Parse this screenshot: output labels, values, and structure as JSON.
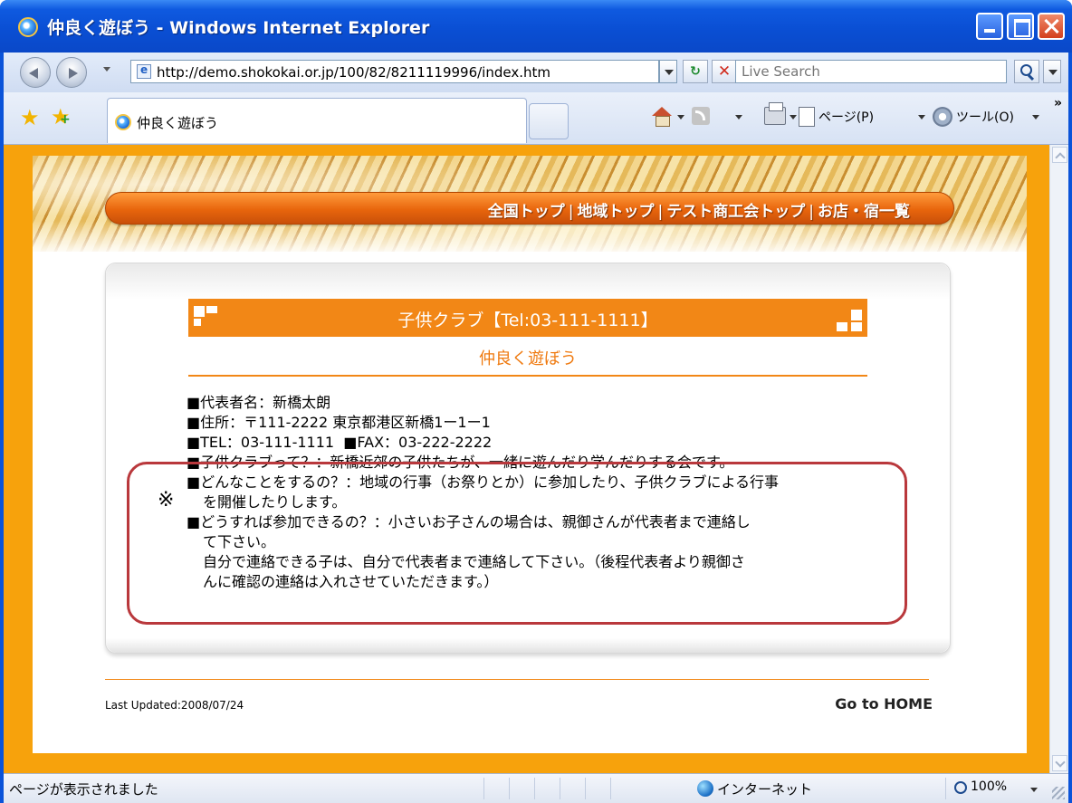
{
  "window": {
    "title": "仲良く遊ぼう - Windows Internet Explorer"
  },
  "toolbar": {
    "address": "http://demo.shokokai.or.jp/100/82/8211119996/index.htm",
    "search_placeholder": "Live Search",
    "page_menu": "ページ(P)",
    "tools_menu": "ツール(O)"
  },
  "tab": {
    "label": "仲良く遊ぼう"
  },
  "site": {
    "nav": [
      "全国トップ",
      "地域トップ",
      "テスト商工会トップ",
      "お店・宿一覧"
    ],
    "nav_separator": "|",
    "heading": "子供クラブ【Tel:03-111-1111】",
    "subtitle": "仲良く遊ぼう",
    "info": {
      "representative": "■代表者名：新橋太朗",
      "address": "■住所：〒111-2222 東京都港区新橋1ー1ー1",
      "tel": "■TEL：03-111-1111",
      "fax": "■FAX：03-222-2222",
      "about": "■子供クラブって？：新橋近郊の子供たちが、一緒に遊んだり学んだりする会です。",
      "activities_1": "■どんなことをするの？：地域の行事（お祭りとか）に参加したり、子供クラブによる行事",
      "activities_2": "を開催したりします。",
      "join_1": "■どうすれば参加できるの？：小さいお子さんの場合は、親御さんが代表者まで連絡し",
      "join_2": "て下さい。",
      "join_3": "自分で連絡できる子は、自分で代表者まで連絡して下さい。（後程代表者より親御さ",
      "join_4": "んに確認の連絡は入れさせていただきます。）"
    },
    "annotation_mark": "※",
    "last_updated": "Last Updated:2008/07/24",
    "go_home": "Go to HOME"
  },
  "status": {
    "text": "ページが表示されました",
    "zone": "インターネット",
    "zoom": "100%"
  },
  "colors": {
    "accent_orange": "#f28716",
    "page_background": "#f7a20c",
    "highlight_border": "#b9383c"
  }
}
